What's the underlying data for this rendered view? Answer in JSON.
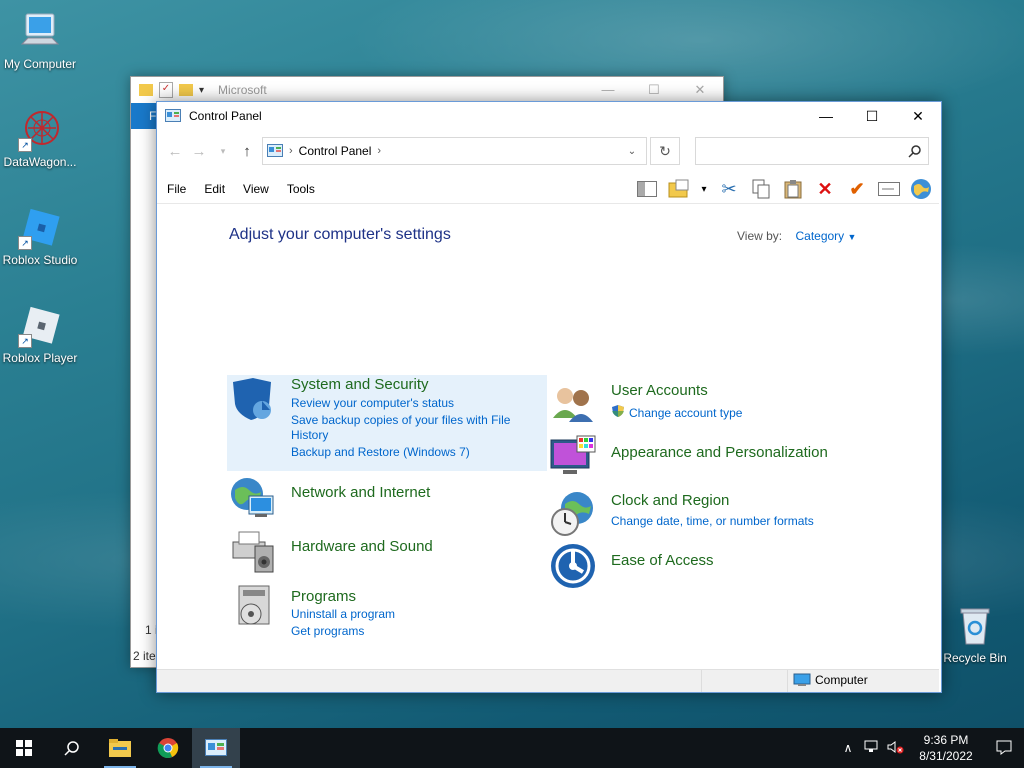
{
  "desktop": {
    "icons": [
      {
        "label": "My Computer"
      },
      {
        "label": "DataWagon..."
      },
      {
        "label": "Roblox Studio"
      },
      {
        "label": "Roblox Player"
      },
      {
        "label": "Recycle Bin"
      }
    ]
  },
  "back_window": {
    "title": "Microsoft",
    "ribbon_tab": "F",
    "status_items": "1 i",
    "status_count": "2 ite"
  },
  "window": {
    "title": "Control Panel",
    "address": {
      "crumb": "Control Panel"
    },
    "search": {
      "placeholder": ""
    },
    "menu": [
      "File",
      "Edit",
      "View",
      "Tools"
    ],
    "heading": "Adjust your computer's settings",
    "view_by": {
      "label": "View by:",
      "value": "Category"
    },
    "categories": {
      "system": {
        "title": "System and Security",
        "links": [
          "Review your computer's status",
          "Save backup copies of your files with File",
          "History",
          "Backup and Restore (Windows 7)"
        ]
      },
      "network": {
        "title": "Network and Internet"
      },
      "hardware": {
        "title": "Hardware and Sound"
      },
      "programs": {
        "title": "Programs",
        "links": [
          "Uninstall a program",
          "Get programs"
        ]
      },
      "users": {
        "title": "User Accounts",
        "links": [
          "Change account type"
        ]
      },
      "appearance": {
        "title": "Appearance and Personalization"
      },
      "clock": {
        "title": "Clock and Region",
        "links": [
          "Change date, time, or number formats"
        ]
      },
      "ease": {
        "title": "Ease of Access"
      }
    },
    "status": {
      "computer": "Computer"
    }
  },
  "taskbar": {
    "time": "9:36 PM",
    "date": "8/31/2022"
  },
  "colors": {
    "heading": "#1e3287",
    "category_title": "#1e6a1e",
    "link": "#0066cc",
    "taskbar": "#0f1418"
  }
}
